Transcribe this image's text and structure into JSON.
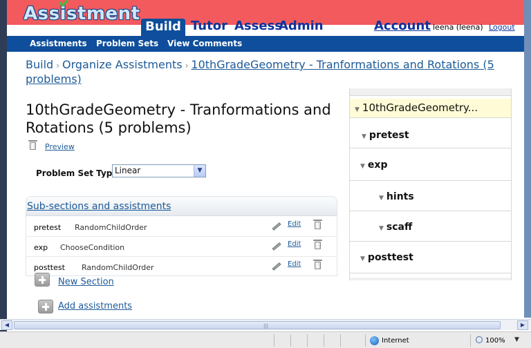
{
  "header": {
    "logo": "Assistment",
    "nav": [
      "Build",
      "Tutor",
      "Assess",
      "Admin"
    ],
    "account": "Account",
    "user": "leena (leena)",
    "logout": "Logout"
  },
  "subnav": [
    "Assistments",
    "Problem Sets",
    "View Comments"
  ],
  "breadcrumb": {
    "items": [
      "Build",
      "Organize Assistments"
    ],
    "current": "10thGradeGeometry - Tranformations and Rotations (5 problems)",
    "separator": "›"
  },
  "main": {
    "title": "10thGradeGeometry - Tranformations and Rotations (5 problems)",
    "preview_label": "Preview",
    "problem_set_type_label": "Problem Set Type:",
    "problem_set_type_value": "Linear",
    "subsections_header": "Sub-sections and assistments",
    "rows": [
      {
        "name": "pretest",
        "type": "RandomChildOrder",
        "edit": "Edit"
      },
      {
        "name": "exp",
        "type": "ChooseCondition",
        "edit": "Edit"
      },
      {
        "name": "posttest",
        "type": "RandomChildOrder",
        "edit": "Edit"
      }
    ],
    "new_section": "New Section",
    "add_assistments": "Add assistments"
  },
  "tree": {
    "root": "10thGradeGeometry...",
    "nodes": [
      "pretest",
      "exp",
      "hints",
      "scaff",
      "posttest"
    ]
  },
  "statusbar": {
    "zone": "Internet",
    "zoom": "100%"
  },
  "colors": {
    "header_red": "#f25a5e",
    "nav_blue": "#0e4e9c",
    "link_blue": "#1d5a98",
    "tree_highlight": "#fffbd6"
  }
}
